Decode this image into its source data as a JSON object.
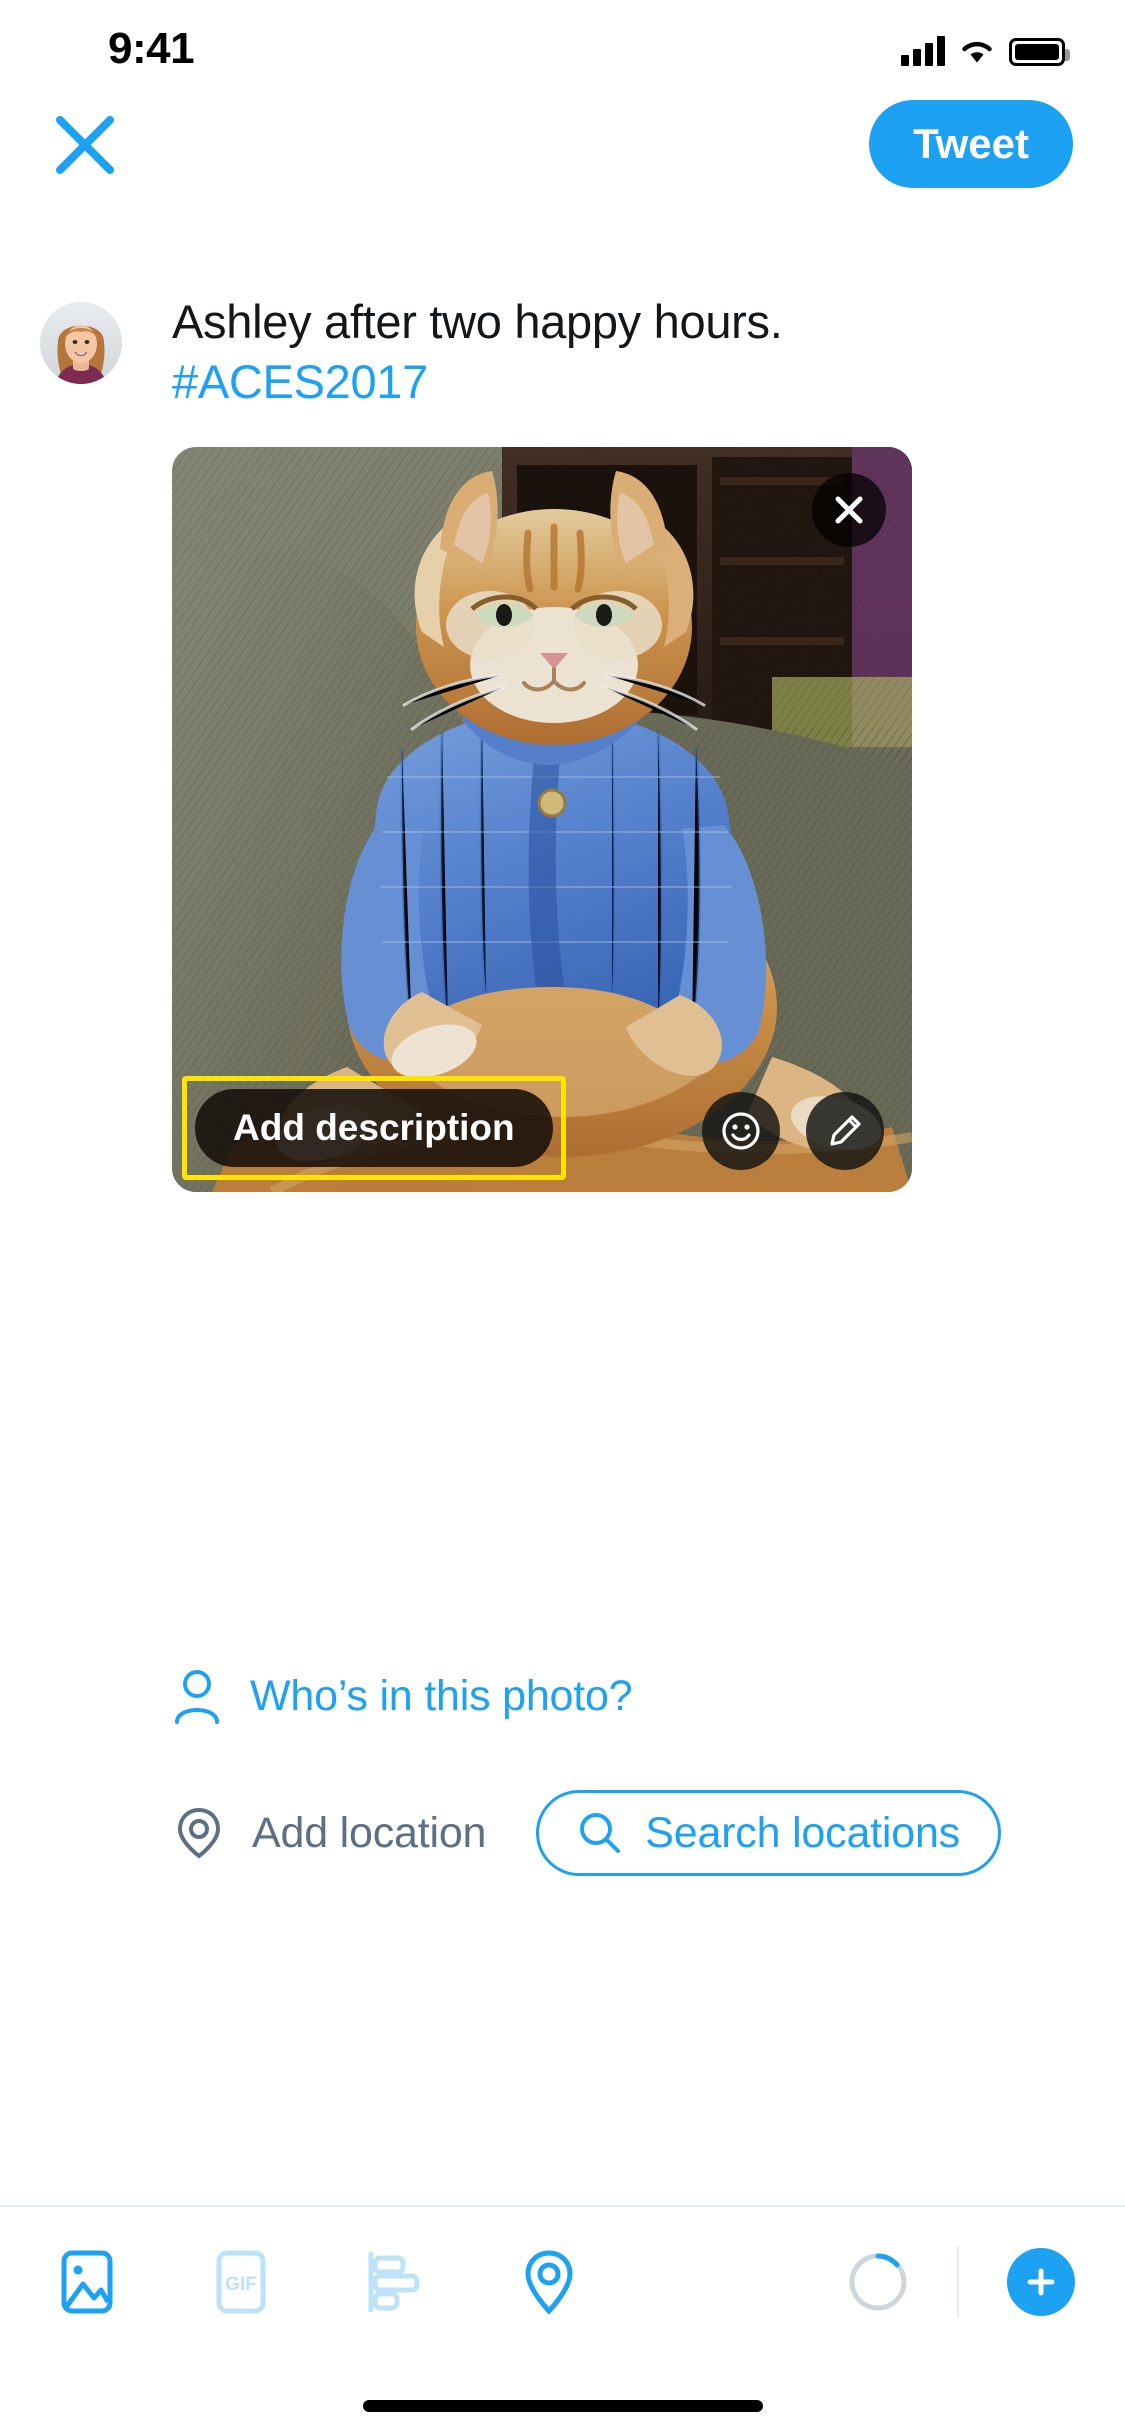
{
  "status_bar": {
    "time": "9:41",
    "signal_icon": "cellular-bars-icon",
    "wifi_icon": "wifi-icon",
    "battery_icon": "battery-full-icon"
  },
  "navbar": {
    "close_icon": "close-x-icon",
    "tweet_button_label": "Tweet"
  },
  "compose": {
    "avatar_name": "user-avatar",
    "text": "Ashley after two happy hours.",
    "hashtag": "#ACES2017"
  },
  "photo": {
    "alt_description": "Orange long-haired cat wearing a blue knitted cardigan sitting upright on a grey couch",
    "remove_icon": "close-x-icon",
    "add_description_label": "Add description",
    "highlight_color": "#FFE400",
    "sticker_icon": "smiley-face-icon",
    "edit_icon": "pencil-icon"
  },
  "tag_people": {
    "icon": "person-icon",
    "label": "Who’s in this photo?"
  },
  "location": {
    "icon": "location-pin-icon",
    "label": "Add location",
    "search_icon": "search-icon",
    "search_label": "Search locations"
  },
  "toolbar": {
    "items": [
      {
        "icon": "photo-icon",
        "state": "active"
      },
      {
        "icon": "gif-icon",
        "state": "disabled",
        "label": "GIF"
      },
      {
        "icon": "poll-icon",
        "state": "disabled"
      },
      {
        "icon": "location-pin-icon",
        "state": "active"
      }
    ],
    "char_count_icon": "character-count-circle-icon",
    "add_tweet_icon": "plus-icon"
  },
  "colors": {
    "accent": "#1DA1F2",
    "text_primary": "#14171A",
    "text_secondary": "#5B7083",
    "highlight": "#FFE400",
    "divider": "#E6ECF0"
  }
}
